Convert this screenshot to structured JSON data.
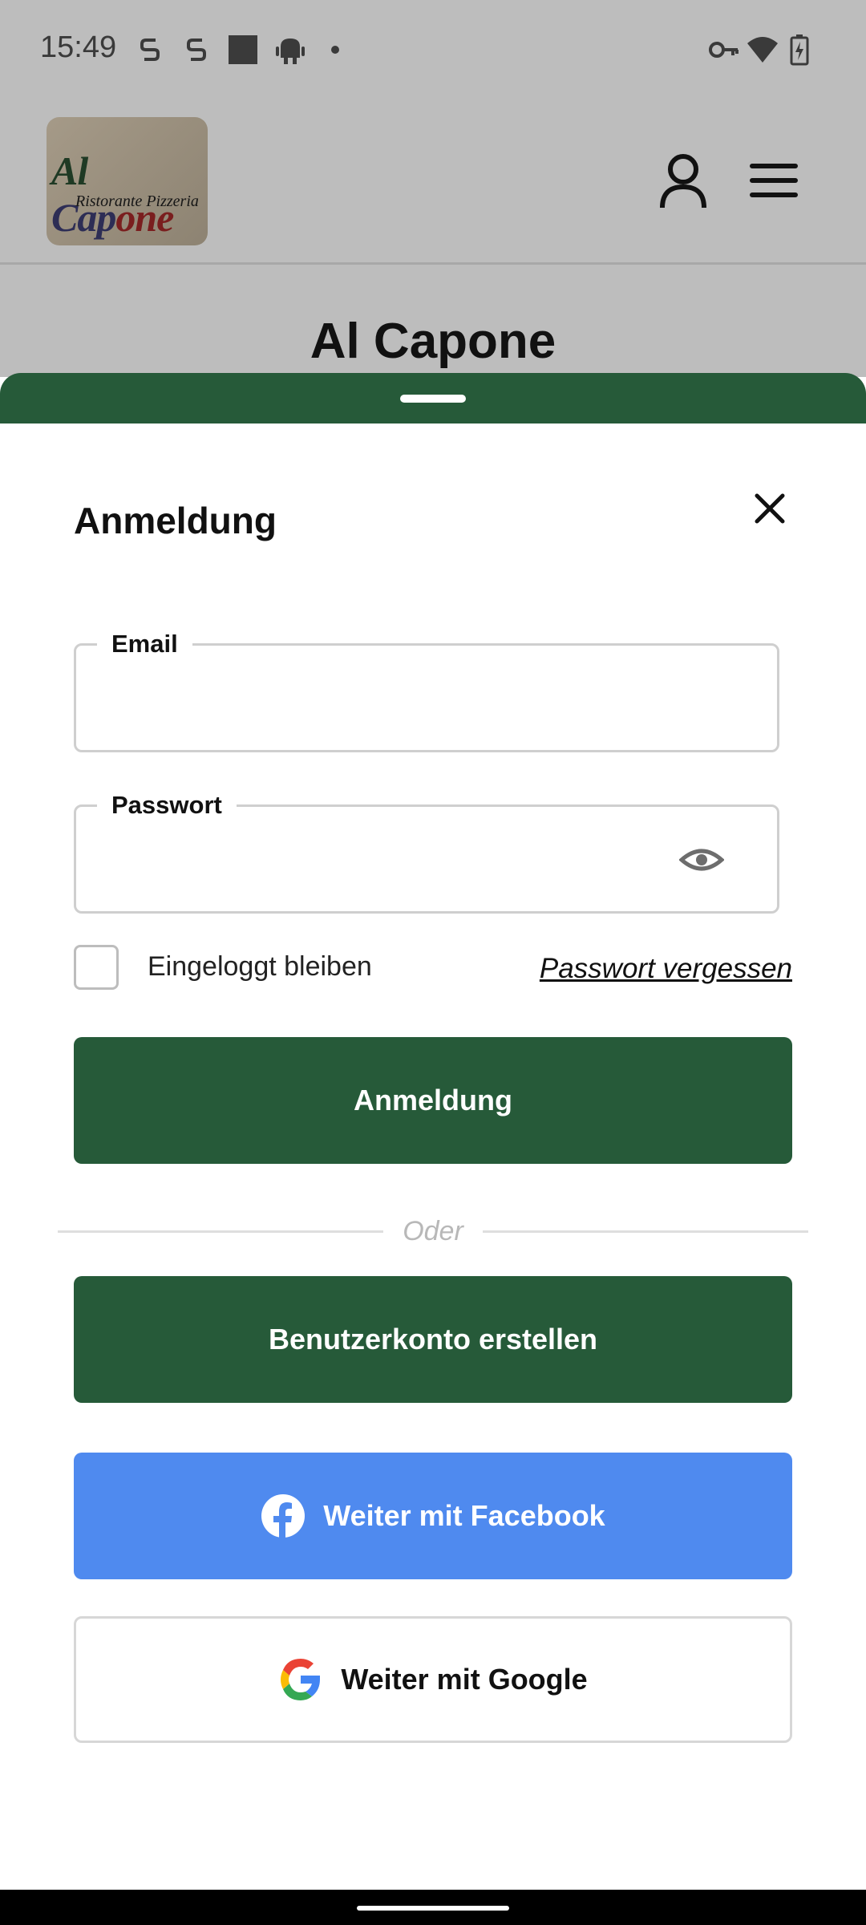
{
  "status_bar": {
    "time": "15:49",
    "left_icons": [
      "notification-s-icon",
      "notification-s-icon",
      "app-square-icon",
      "android-icon",
      "dot-icon"
    ],
    "right_icons": [
      "vpn-key-icon",
      "wifi-icon",
      "battery-charging-icon"
    ]
  },
  "header": {
    "logo_text_main": "Al Capone",
    "logo_text_sub": "Ristorante Pizzeria",
    "profile_icon": "user-icon",
    "menu_icon": "hamburger-menu-icon"
  },
  "page": {
    "title": "Al Capone"
  },
  "login_sheet": {
    "title": "Anmeldung",
    "close_icon": "close-icon",
    "email": {
      "label": "Email",
      "value": "",
      "placeholder": ""
    },
    "password": {
      "label": "Passwort",
      "value": "",
      "placeholder": "",
      "toggle_icon": "eye-icon"
    },
    "remember_label": "Eingeloggt bleiben",
    "remember_checked": false,
    "forgot_label": "Passwort vergessen",
    "submit_label": "Anmeldung",
    "divider_label": "Oder",
    "register_label": "Benutzerkonto erstellen",
    "facebook_label": "Weiter mit Facebook",
    "google_label": "Weiter mit Google"
  },
  "colors": {
    "primary_green": "#265a39",
    "facebook_blue": "#4f8aef",
    "dim_overlay": "#bdbdbd"
  }
}
